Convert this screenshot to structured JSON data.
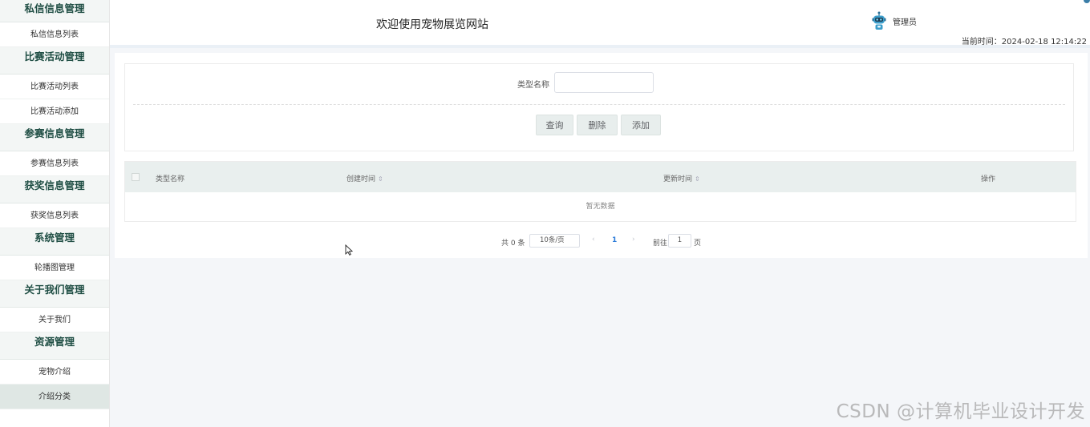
{
  "sidebar": {
    "groups": [
      {
        "title": "私信信息管理",
        "items": [
          "私信信息列表"
        ]
      },
      {
        "title": "比赛活动管理",
        "items": [
          "比赛活动列表",
          "比赛活动添加"
        ]
      },
      {
        "title": "参赛信息管理",
        "items": [
          "参赛信息列表"
        ]
      },
      {
        "title": "获奖信息管理",
        "items": [
          "获奖信息列表"
        ]
      },
      {
        "title": "系统管理",
        "items": [
          "轮播图管理"
        ]
      },
      {
        "title": "关于我们管理",
        "items": [
          "关于我们"
        ]
      },
      {
        "title": "资源管理",
        "items": [
          "宠物介绍",
          "介绍分类"
        ]
      }
    ],
    "active_item": "介绍分类"
  },
  "header": {
    "title": "欢迎使用宠物展览网站",
    "user": "管理员",
    "avatar_icon": "robot-avatar-icon",
    "current_time": "当前时间：2024-02-18 12:14:22"
  },
  "search": {
    "label": "类型名称",
    "value": "",
    "placeholder": ""
  },
  "buttons": {
    "query": "查询",
    "delete": "删除",
    "add": "添加"
  },
  "table": {
    "columns": [
      "类型名称",
      "创建时间",
      "更新时间",
      "操作"
    ],
    "sort_icon": "sort-caret-icon",
    "empty_text": "暂无数据"
  },
  "pagination": {
    "total": "共 0 条",
    "page_size": "10条/页",
    "current_page": "1",
    "goto_label": "前往",
    "goto_value": "1",
    "goto_suffix": "页"
  },
  "watermark": "CSDN @计算机毕业设计开发",
  "colors": {
    "sidebar_title": "#1f4e44",
    "active_bg": "#dfe7e4",
    "table_header_bg": "#e9efee",
    "page_link": "#2b7bd9"
  }
}
